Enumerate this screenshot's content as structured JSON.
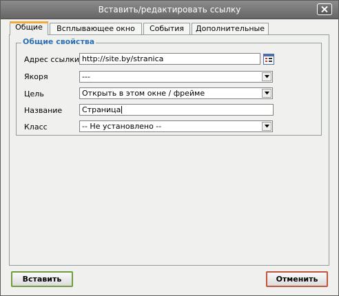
{
  "dialog": {
    "title": "Вставить/редактировать ссылку",
    "close_icon": "close-x-icon"
  },
  "tabs": [
    {
      "label": "Общие",
      "active": true
    },
    {
      "label": "Всплывающее окно",
      "active": false
    },
    {
      "label": "События",
      "active": false
    },
    {
      "label": "Дополнительные",
      "active": false
    }
  ],
  "general": {
    "legend": "Общие свойства",
    "fields": {
      "url": {
        "label": "Адрес ссылки",
        "value": "http://site.by/stranica",
        "browse_icon": "browse-list-icon"
      },
      "anchors": {
        "label": "Якоря",
        "value": "---"
      },
      "target": {
        "label": "Цель",
        "value": "Открыть в этом окне / фрейме"
      },
      "title": {
        "label": "Название",
        "value": "Страница"
      },
      "class": {
        "label": "Класс",
        "value": "-- Не установлено --"
      }
    }
  },
  "buttons": {
    "insert": "Вставить",
    "cancel": "Отменить"
  },
  "colors": {
    "accent_tab": "#f2a93b",
    "legend": "#2b6fb3",
    "insert_border": "#6f9b3c",
    "cancel_border": "#c2523b"
  }
}
